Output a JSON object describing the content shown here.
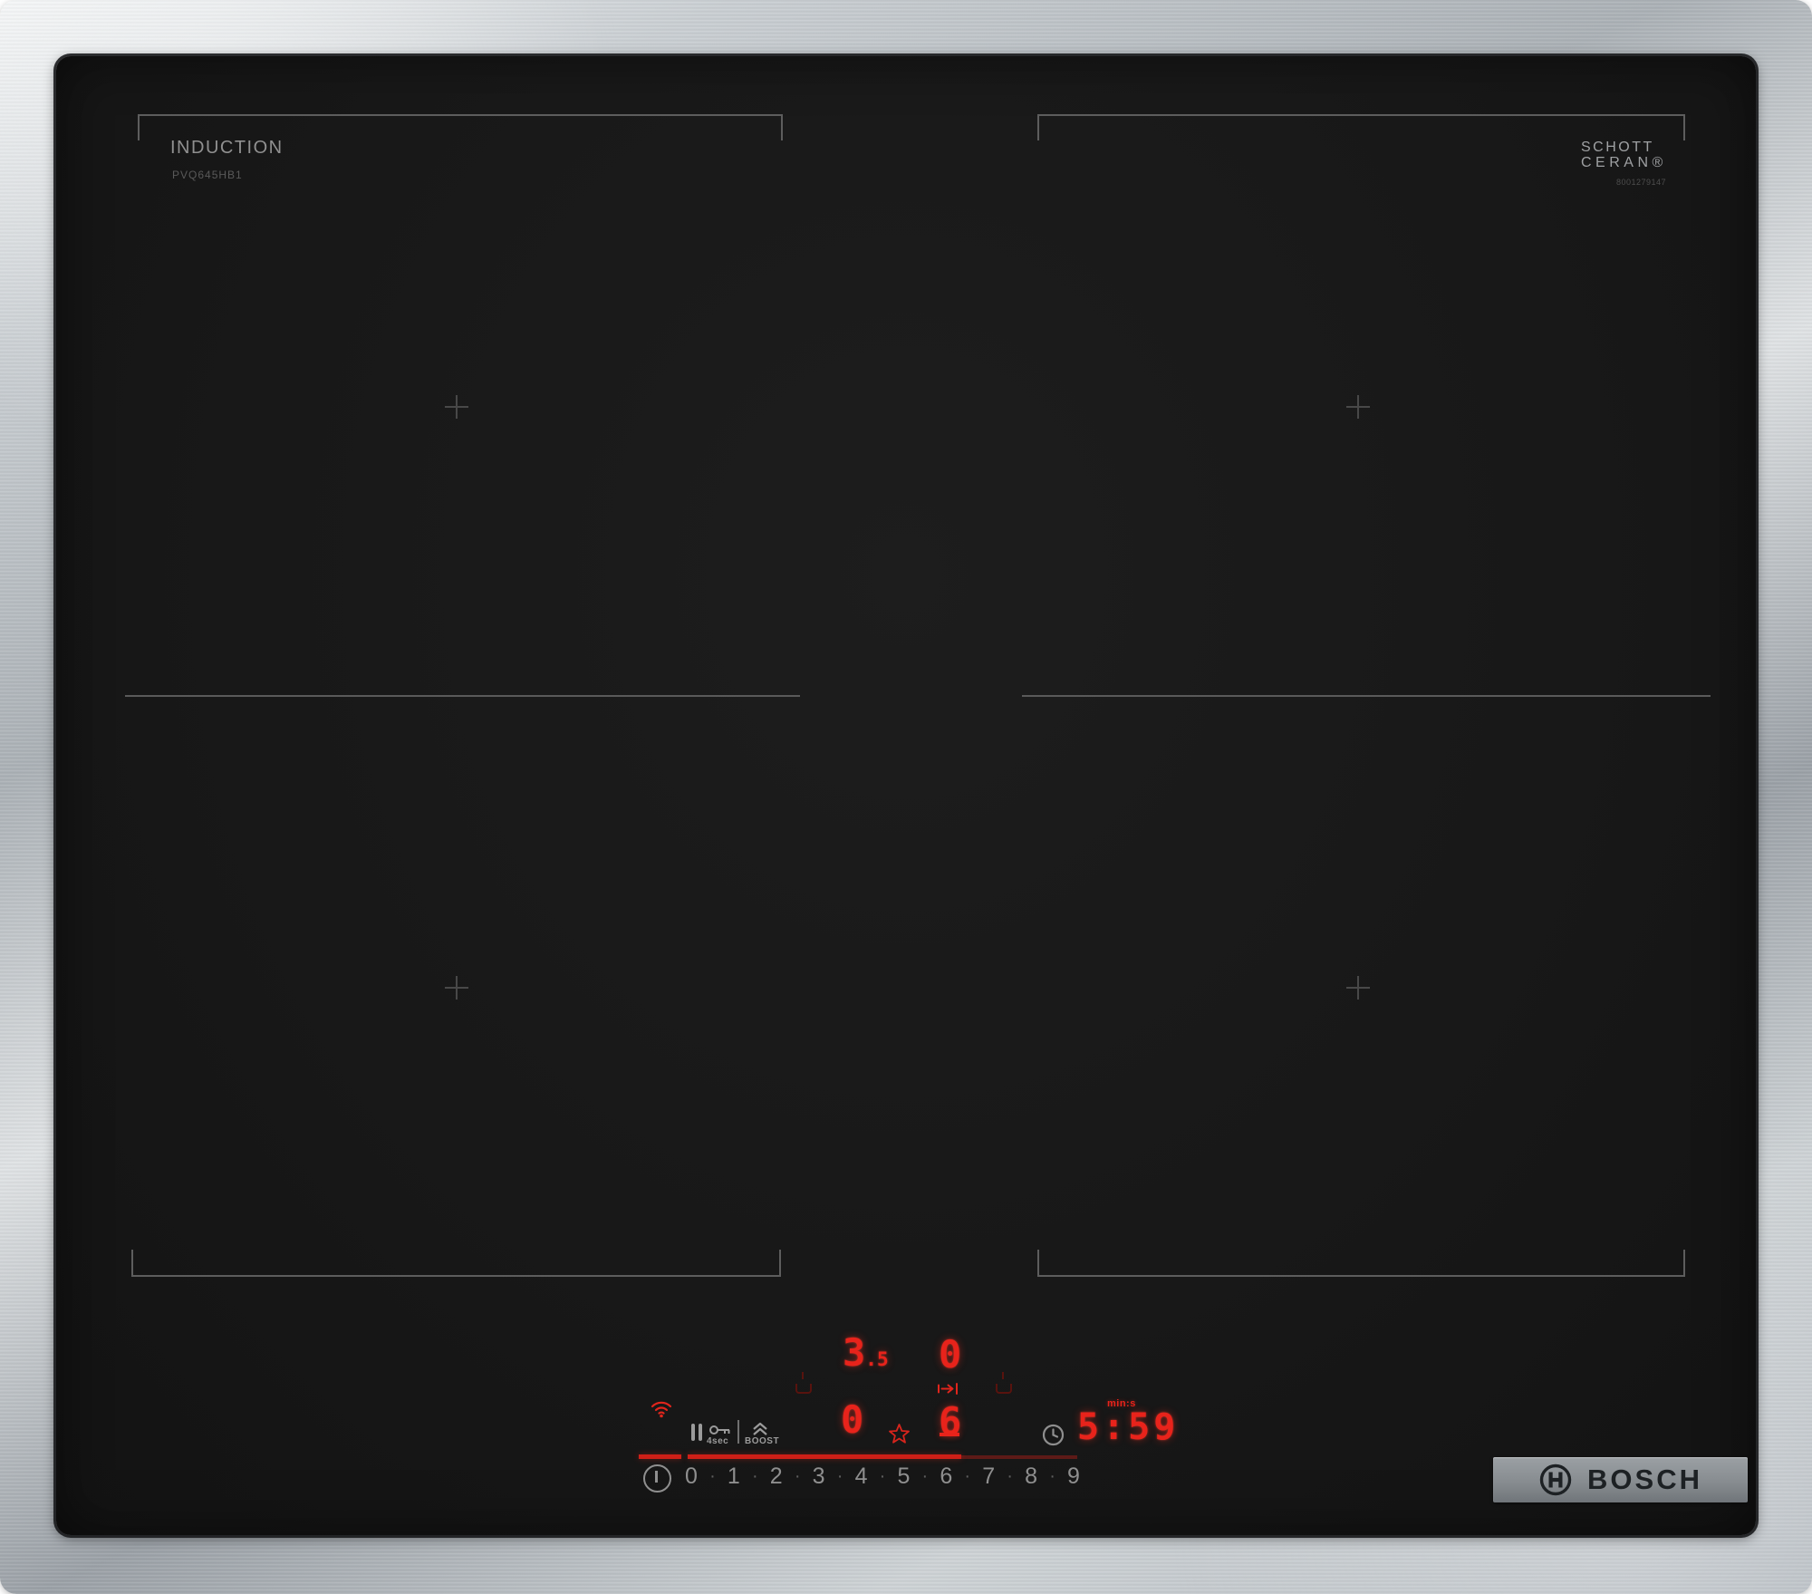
{
  "branding": {
    "type_label": "INDUCTION",
    "model": "PVQ645HB1",
    "glass_maker_line1": "SCHOTT",
    "glass_maker_line2": "CERAN®",
    "serial": "8001279147",
    "logo_text": "BOSCH"
  },
  "readouts": {
    "rear_left_main": "3",
    "rear_left_decimal": ".5",
    "rear_right": "0",
    "front_left": "0",
    "selected_zone_level": "6",
    "timer_unit_label": "min:s",
    "timer_value": "5:59"
  },
  "controls": {
    "lock_duration_label": "4sec",
    "boost_label": "BOOST",
    "power_levels": [
      "0",
      "1",
      "2",
      "3",
      "4",
      "5",
      "6",
      "7",
      "8",
      "9"
    ],
    "level_separator": "·"
  },
  "colors": {
    "led_red": "#e8231b",
    "led_dim_red": "#58130e",
    "icon_gray": "#9b9b9b",
    "zone_line_gray": "#5d5d5d",
    "steel_silver": "#c9ced2",
    "glass_black": "#181818"
  }
}
